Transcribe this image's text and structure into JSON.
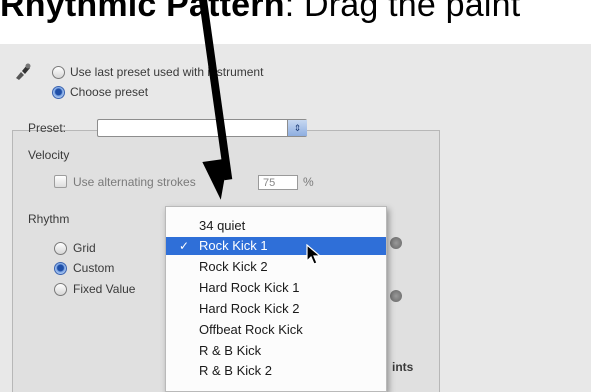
{
  "heading": {
    "bold": "Rhythmic Pattern",
    "rest": ": Drag the paint"
  },
  "preset_source": {
    "option_last": "Use last preset used with instrument",
    "option_choose": "Choose preset"
  },
  "preset": {
    "label": "Preset:",
    "value": ""
  },
  "velocity": {
    "label": "Velocity",
    "alternating_label": "Use alternating strokes",
    "value": "75",
    "unit": "%"
  },
  "rhythm": {
    "label": "Rhythm",
    "options": [
      "Grid",
      "Custom",
      "Fixed Value"
    ],
    "selected": "Custom"
  },
  "footer_fragment": "ints",
  "dropdown": {
    "items": [
      "34 quiet",
      "Rock Kick 1",
      "Rock Kick 2",
      "Hard Rock Kick 1",
      "Hard Rock Kick 2",
      "Offbeat Rock Kick",
      "R & B Kick",
      "R & B Kick 2"
    ],
    "selected": "Rock Kick 1",
    "check": "✓"
  },
  "colors": {
    "menu_selection": "#2f6fd8",
    "panel": "#e8e8e8",
    "arrow": "#000000"
  }
}
